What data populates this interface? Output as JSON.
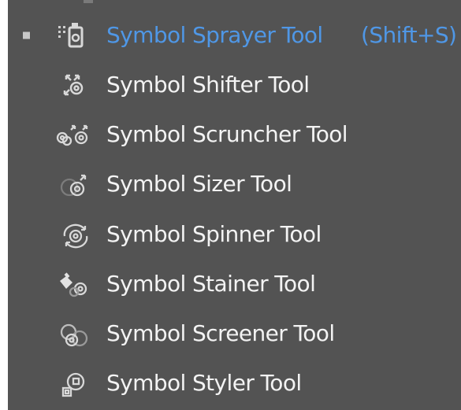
{
  "menu": {
    "items": [
      {
        "icon": "symbol-sprayer-icon",
        "label": "Symbol Sprayer Tool",
        "shortcut": "(Shift+S)",
        "active": true
      },
      {
        "icon": "symbol-shifter-icon",
        "label": "Symbol Shifter Tool"
      },
      {
        "icon": "symbol-scruncher-icon",
        "label": "Symbol Scruncher Tool"
      },
      {
        "icon": "symbol-sizer-icon",
        "label": "Symbol Sizer Tool"
      },
      {
        "icon": "symbol-spinner-icon",
        "label": "Symbol Spinner Tool"
      },
      {
        "icon": "symbol-stainer-icon",
        "label": "Symbol Stainer Tool"
      },
      {
        "icon": "symbol-screener-icon",
        "label": "Symbol Screener Tool"
      },
      {
        "icon": "symbol-styler-icon",
        "label": "Symbol Styler Tool"
      }
    ]
  },
  "colors": {
    "background": "#535353",
    "text": "#f3f3f3",
    "accent": "#4f97e6",
    "icon": "#d8d8d8"
  }
}
